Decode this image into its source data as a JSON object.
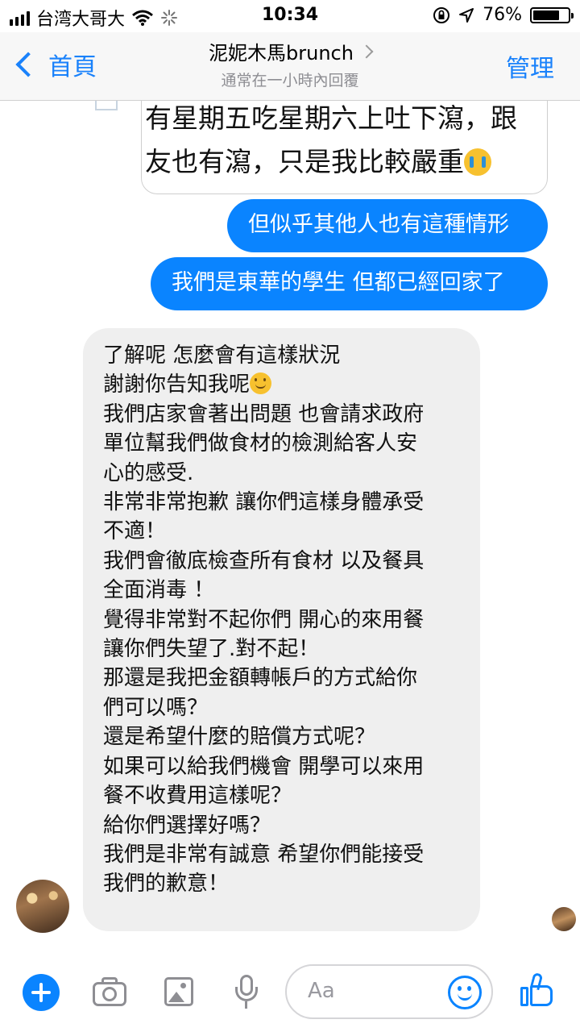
{
  "status_bar": {
    "carrier": "台湾大哥大",
    "time": "10:34",
    "battery_percent": "76%",
    "battery_level": 0.76,
    "icons": [
      "signal-icon",
      "wifi-icon",
      "loading-icon",
      "orientation-lock-icon",
      "location-icon",
      "battery-icon"
    ]
  },
  "nav": {
    "back_label": "首頁",
    "title": "泥妮木馬brunch",
    "subtitle": "通常在一小時內回覆",
    "manage_label": "管理"
  },
  "chat": {
    "quoted_message": {
      "lines": [
        "有星期五吃星期六上吐下瀉，跟",
        "友也有瀉，只是我比較嚴重"
      ],
      "trailing_emoji": "crying-face-emoji"
    },
    "outgoing": [
      "但似乎其他人也有這種情形",
      "我們是東華的學生 但都已經回家了"
    ],
    "incoming_lines": [
      "了解呢 怎麼會有這樣狀況",
      "謝謝你告知我呢",
      "我們店家會著出問題 也會請求政府",
      "單位幫我們做食材的檢測給客人安",
      "心的感受.",
      "非常非常抱歉 讓你們這樣身體承受",
      "不適！",
      "我們會徹底檢查所有食材 以及餐具",
      "全面消毒 ！",
      "覺得非常對不起你們 開心的來用餐",
      "讓你們失望了.對不起！",
      "那還是我把金額轉帳戶的方式給你",
      "們可以嗎？",
      "還是希望什麼的賠償方式呢？",
      "如果可以給我們機會 開學可以來用",
      "餐不收費用這樣呢？",
      "給你們選擇好嗎？",
      "我們是非常有誠意 希望你們能接受",
      "我們的歉意！"
    ],
    "incoming_emoji_after_line_2": "smiling-face-emoji"
  },
  "composer": {
    "placeholder": "Aa",
    "icons": [
      "plus-icon",
      "camera-icon",
      "photo-icon",
      "microphone-icon",
      "emoji-icon",
      "thumbs-up-icon"
    ]
  },
  "colors": {
    "accent": "#0a84ff",
    "nav_link": "#1a82fb",
    "incoming_bubble": "#efefef",
    "nav_background": "#f7f7f7"
  }
}
